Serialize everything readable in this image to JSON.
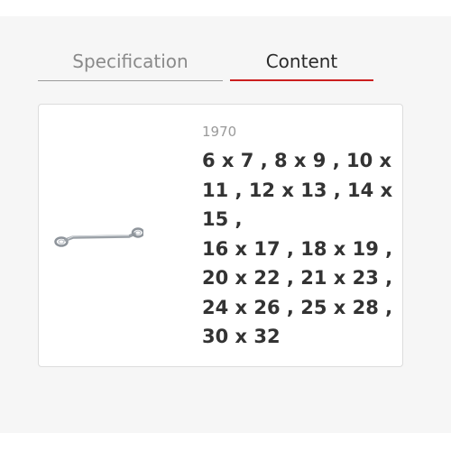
{
  "tabs": [
    {
      "label": "Specification",
      "active": false
    },
    {
      "label": "Content",
      "active": true
    }
  ],
  "colors": {
    "panel_background": "#f6f6f6",
    "active_tab_underline": "#cc1f1f",
    "inactive_tab_underline": "#9a9a9a",
    "card_border": "#dcdcdc"
  },
  "product": {
    "image_icon": "double-ended-ring-spanner",
    "code": "1970",
    "size_lines": [
      "6 x 7 , 8 x 9 , 10 x",
      "11 , 12 x 13 , 14 x",
      "15 ,",
      "16 x 17 , 18 x 19 ,",
      "20 x 22 , 21 x 23 ,",
      "24 x 26 , 25 x 28 ,",
      "30 x 32"
    ]
  }
}
